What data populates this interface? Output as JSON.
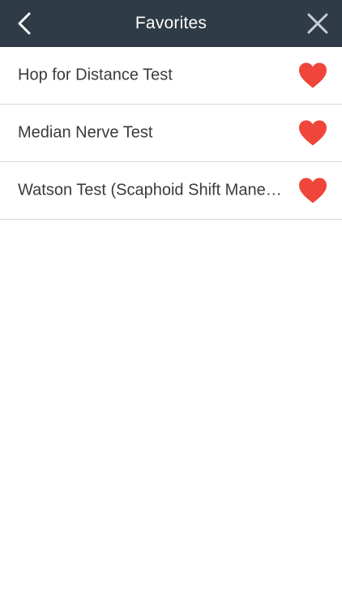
{
  "header": {
    "title": "Favorites",
    "back_icon": "chevron-left-icon",
    "close_icon": "close-icon",
    "background_color": "#2f3b46"
  },
  "favorites": {
    "items": [
      {
        "label": "Hop for Distance Test",
        "icon": "heart-icon"
      },
      {
        "label": "Median Nerve Test",
        "icon": "heart-icon"
      },
      {
        "label": "Watson Test (Scaphoid Shift Maneuver)",
        "icon": "heart-icon"
      }
    ],
    "heart_color": "#f0453a"
  }
}
